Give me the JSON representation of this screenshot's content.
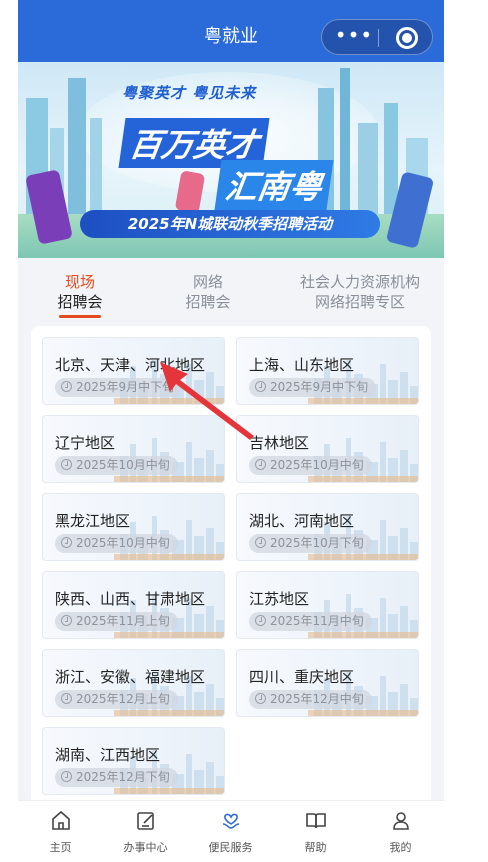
{
  "header": {
    "title": "粤就业"
  },
  "banner": {
    "slogan": "粤聚英才  粤见未来",
    "headline_1": "百万英才",
    "headline_2": "汇南粤",
    "event_title": "2025年N城联动秋季招聘活动"
  },
  "tabs": [
    {
      "line1": "现场",
      "line2": "招聘会"
    },
    {
      "line1": "网络",
      "line2": "招聘会"
    },
    {
      "line1": "社会人力资源机构",
      "line2": "网络招聘专区"
    }
  ],
  "regions": [
    {
      "name": "北京、天津、河北地区",
      "date": "2025年9月中下旬"
    },
    {
      "name": "上海、山东地区",
      "date": "2025年9月中下旬"
    },
    {
      "name": "辽宁地区",
      "date": "2025年10月中旬"
    },
    {
      "name": "吉林地区",
      "date": "2025年10月中旬"
    },
    {
      "name": "黑龙江地区",
      "date": "2025年10月中旬"
    },
    {
      "name": "湖北、河南地区",
      "date": "2025年10月下旬"
    },
    {
      "name": "陕西、山西、甘肃地区",
      "date": "2025年11月上旬"
    },
    {
      "name": "江苏地区",
      "date": "2025年11月中旬"
    },
    {
      "name": "浙江、安徽、福建地区",
      "date": "2025年12月上旬"
    },
    {
      "name": "四川、重庆地区",
      "date": "2025年12月中旬"
    },
    {
      "name": "湖南、江西地区",
      "date": "2025年12月下旬"
    }
  ],
  "bottom_nav": [
    {
      "label": "主页",
      "icon": "home-icon"
    },
    {
      "label": "办事中心",
      "icon": "edit-icon"
    },
    {
      "label": "便民服务",
      "icon": "heart-hand-icon"
    },
    {
      "label": "帮助",
      "icon": "book-icon"
    },
    {
      "label": "我的",
      "icon": "person-icon"
    }
  ],
  "colors": {
    "header": "#2b6bd9",
    "accent": "#e34a1f",
    "active_nav": "#2b6bd9"
  }
}
